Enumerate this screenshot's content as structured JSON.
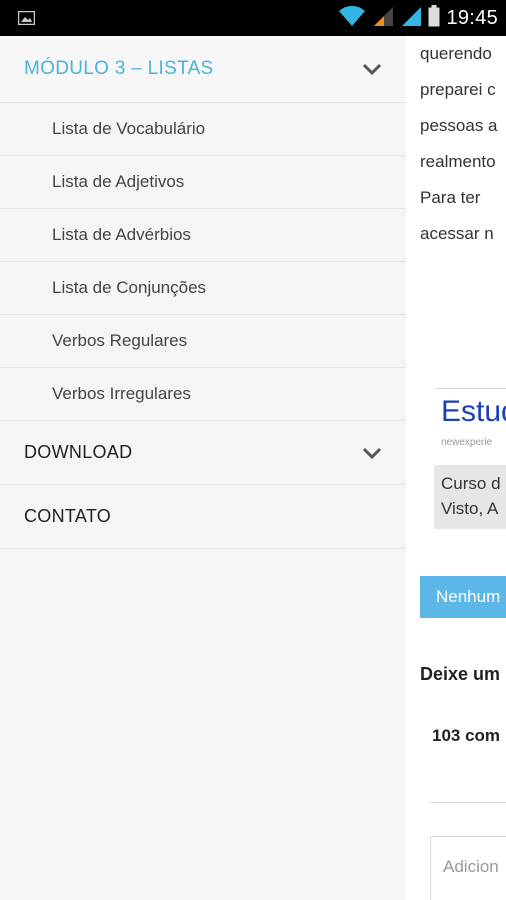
{
  "status_bar": {
    "time": "19:45",
    "icons": [
      "image-icon",
      "wifi-icon",
      "signal-orange-icon",
      "signal-blue-icon",
      "battery-icon"
    ]
  },
  "drawer": {
    "section": {
      "title": "MÓDULO 3 – LISTAS",
      "expanded": true,
      "items": [
        {
          "label": "Lista de Vocabulário"
        },
        {
          "label": "Lista de Adjetivos"
        },
        {
          "label": "Lista de Advérbios"
        },
        {
          "label": "Lista de Conjunções"
        },
        {
          "label": "Verbos Regulares"
        },
        {
          "label": "Verbos Irregulares"
        }
      ]
    },
    "download": "DOWNLOAD",
    "contato": "CONTATO"
  },
  "page": {
    "paragraph_lines": [
      "querendo",
      "preparei c",
      "pessoas a",
      "realmento",
      "Para  ter",
      "acessar n"
    ],
    "ad": {
      "title": "Estud",
      "url": "newexperie",
      "lines": [
        "Curso d",
        "Visto, A"
      ]
    },
    "no_comments_button": "Nenhum",
    "leave_comment_heading": "Deixe um",
    "comments_count": "103 com",
    "add_comment_placeholder": "Adicion"
  },
  "colors": {
    "accent": "#4ab2dc",
    "button": "#5cb6e8",
    "ad_title": "#1a3fb8"
  }
}
